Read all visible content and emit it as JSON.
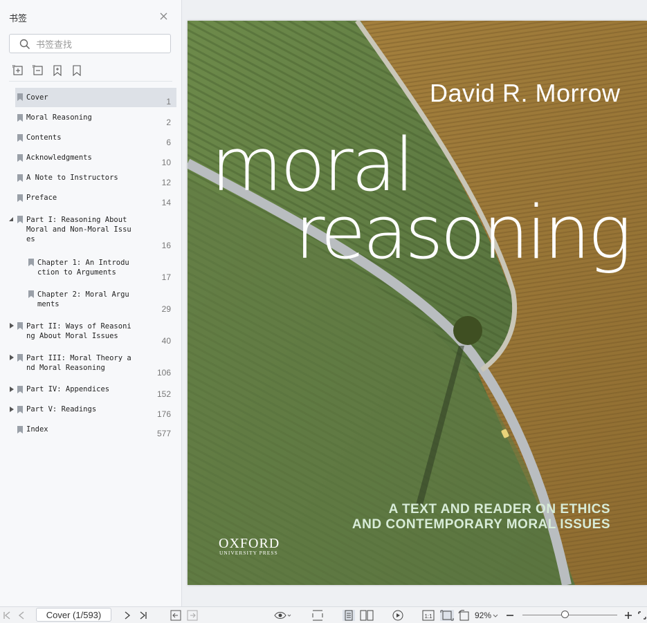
{
  "sidebar": {
    "title": "书签",
    "search_placeholder": "书签查找",
    "bookmarks": [
      {
        "label": "Cover",
        "page": "1"
      },
      {
        "label": "Moral Reasoning",
        "page": "2"
      },
      {
        "label": "Contents",
        "page": "6"
      },
      {
        "label": "Acknowledgments",
        "page": "10"
      },
      {
        "label": "A Note to Instructors",
        "page": "12"
      },
      {
        "label": "Preface",
        "page": "14"
      },
      {
        "label": "Part I: Reasoning About\nMoral and Non-Moral Issu\nes",
        "page": "16"
      },
      {
        "label": "Chapter 1: An Introdu\nction to Arguments",
        "page": "17"
      },
      {
        "label": "Chapter 2: Moral Argu\nments",
        "page": "29"
      },
      {
        "label": "Part II: Ways of Reasoni\nng About Moral Issues",
        "page": "40"
      },
      {
        "label": "Part III: Moral Theory a\nnd Moral Reasoning",
        "page": "106"
      },
      {
        "label": "Part IV: Appendices",
        "page": "152"
      },
      {
        "label": "Part V: Readings",
        "page": "176"
      },
      {
        "label": "Index",
        "page": "577"
      }
    ]
  },
  "cover": {
    "author": "David R. Morrow",
    "title_line1": "moral",
    "title_line2": "reasoning",
    "subtitle_line1": "A TEXT AND READER ON ETHICS",
    "subtitle_line2": "AND CONTEMPORARY MORAL ISSUES",
    "publisher": "OXFORD",
    "publisher_sub": "UNIVERSITY PRESS"
  },
  "statusbar": {
    "page_indicator": "Cover (1/593)",
    "zoom": "92%",
    "zoom_level": 0.46
  },
  "colors": {
    "field_left": "#5f7a45",
    "field_right": "#9b7a3a",
    "road": "#b9bdc0"
  }
}
